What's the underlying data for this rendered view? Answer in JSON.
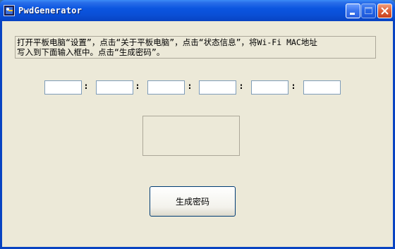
{
  "window": {
    "title": "PwdGenerator"
  },
  "instruction": {
    "text": "打开平板电脑“设置”，点击“关于平板电脑”，点击“状态信息”，将Wi-Fi MAC地址\n写入到下面输入框中。点击“生成密码”。"
  },
  "mac_fields": [
    {
      "value": ""
    },
    {
      "value": ""
    },
    {
      "value": ""
    },
    {
      "value": ""
    },
    {
      "value": ""
    },
    {
      "value": ""
    }
  ],
  "separator": ":",
  "result": {
    "text": ""
  },
  "generate_button": {
    "label": "生成密码"
  },
  "colors": {
    "titlebar": "#0a4fd6",
    "client_background": "#ece9d8",
    "input_border": "#7f9db9"
  }
}
